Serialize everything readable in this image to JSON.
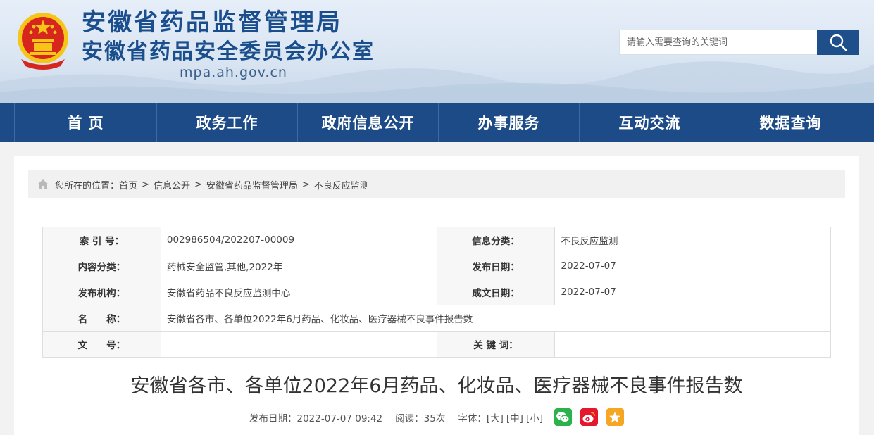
{
  "header": {
    "title_line1": "安徽省药品监督管理局",
    "title_line2": "安徽省药品安全委员会办公室",
    "domain": "mpa.ah.gov.cn",
    "search_placeholder": "请输入需要查询的关键词"
  },
  "nav": {
    "items": [
      {
        "label": "首 页"
      },
      {
        "label": "政务工作"
      },
      {
        "label": "政府信息公开"
      },
      {
        "label": "办事服务"
      },
      {
        "label": "互动交流"
      },
      {
        "label": "数据查询"
      }
    ]
  },
  "breadcrumb": {
    "prefix": "您所在的位置：",
    "items": [
      "首页",
      "信息公开",
      "安徽省药品监督管理局",
      "不良反应监测"
    ],
    "separator": ">"
  },
  "info_table": {
    "index_label": "索 引 号：",
    "index_value": "002986504/202207-00009",
    "category_label": "信息分类：",
    "category_value": "不良反应监测",
    "content_label": "内容分类：",
    "content_value": "药械安全监管,其他,2022年",
    "pub_date_label": "发布日期：",
    "pub_date_value": "2022-07-07",
    "org_label": "发布机构：",
    "org_value": "安徽省药品不良反应监测中心",
    "made_date_label": "成文日期：",
    "made_date_value": "2022-07-07",
    "name_label": "名　　称：",
    "name_value": "安徽省各市、各单位2022年6月药品、化妆品、医疗器械不良事件报告数",
    "doc_no_label": "文　　号：",
    "doc_no_value": "",
    "keywords_label": "关 键 词：",
    "keywords_value": ""
  },
  "article": {
    "title": "安徽省各市、各单位2022年6月药品、化妆品、医疗器械不良事件报告数",
    "pub_date": "发布日期：2022-07-07 09:42",
    "reads": "阅读：35次",
    "font_label": "字体：",
    "font_large": "[大]",
    "font_medium": "[中]",
    "font_small": "[小]"
  },
  "colors": {
    "nav_bg": "#1d4b87",
    "title_blue": "#1a4e8c",
    "wechat": "#2bb24c",
    "weibo": "#e6162d",
    "favorite": "#f5a623"
  }
}
